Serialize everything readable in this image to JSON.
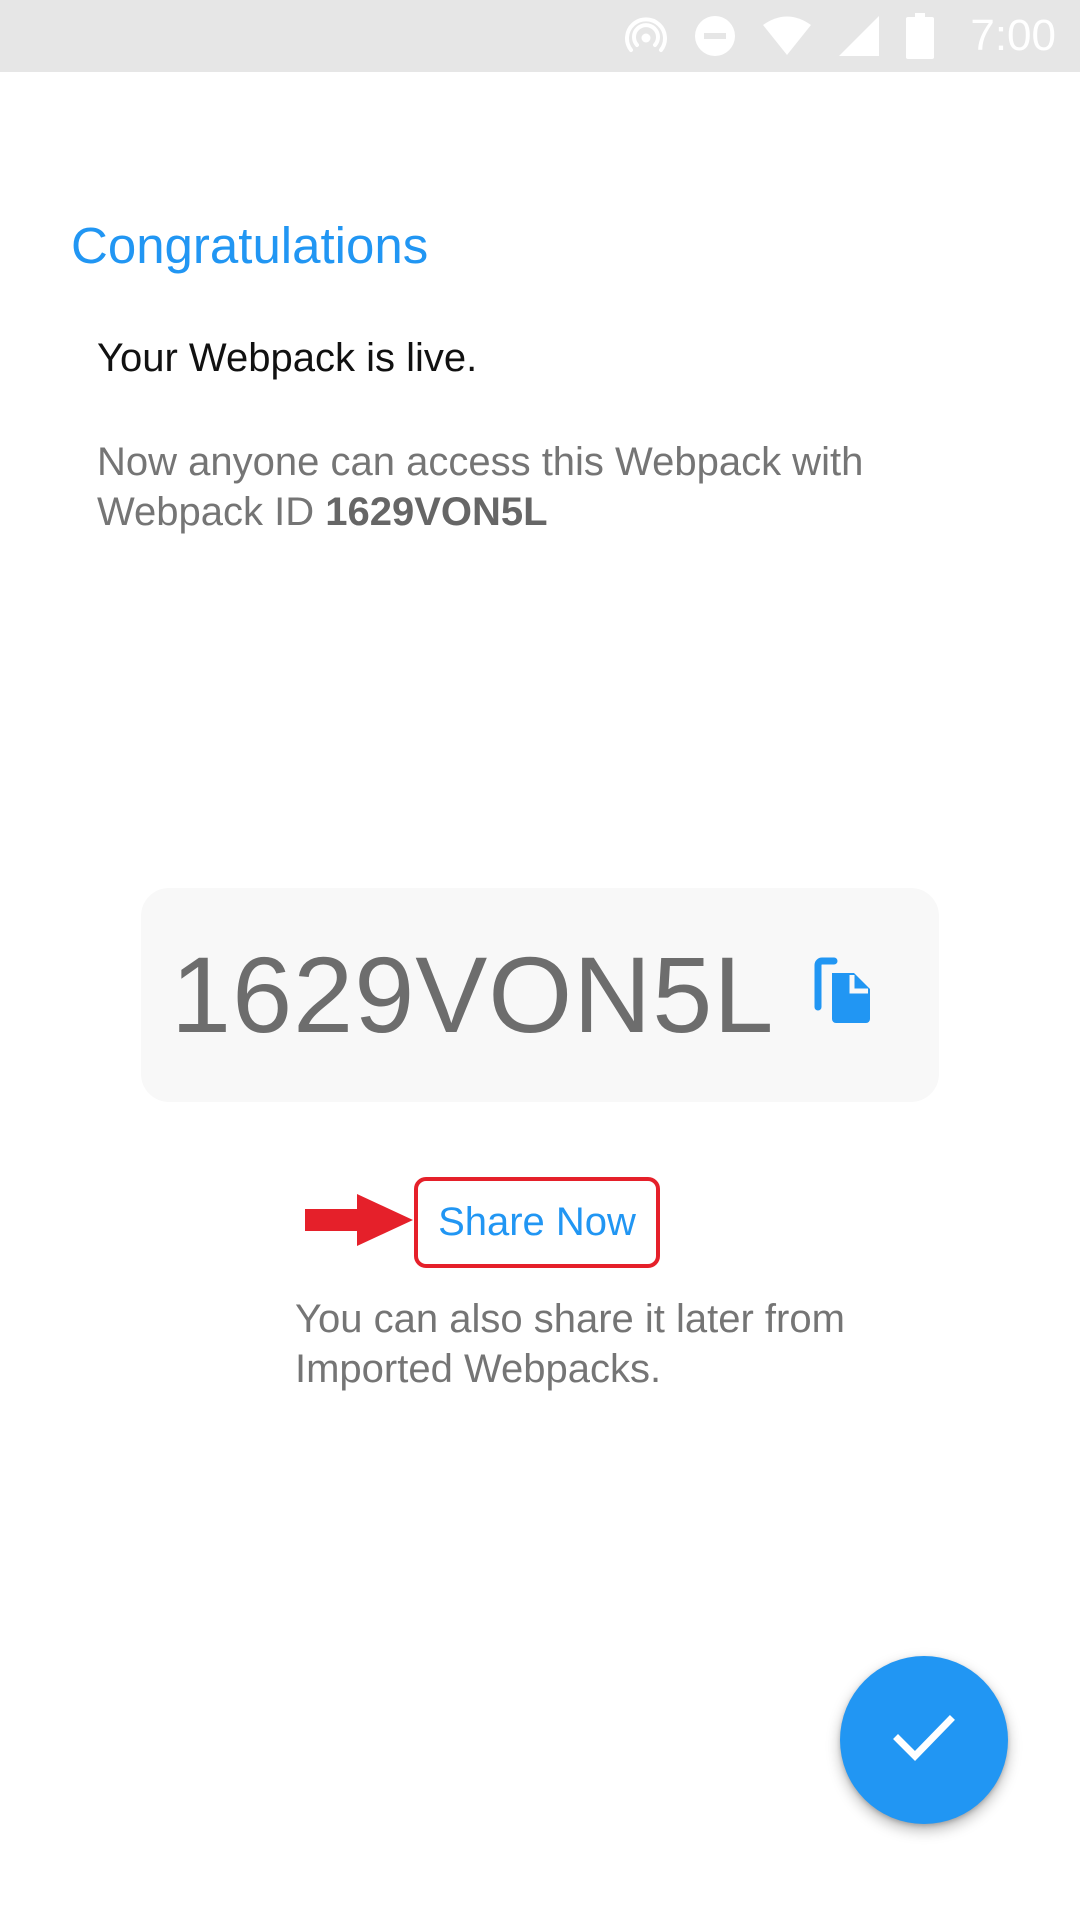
{
  "status_bar": {
    "time": "7:00",
    "icons": [
      "hotspot-icon",
      "do-not-disturb-icon",
      "wifi-icon",
      "cell-signal-icon",
      "battery-icon"
    ]
  },
  "header": {
    "title": "Congratulations"
  },
  "main": {
    "subtitle": "Your Webpack is live.",
    "description_prefix": "Now anyone can access this Webpack with Webpack ID ",
    "webpack_id": "1629VON5L",
    "id_card": {
      "id": "1629VON5L",
      "copy_icon": "copy-icon"
    },
    "share": {
      "label": "Share Now",
      "hint": "You can also share it later from Imported Webpacks."
    }
  },
  "fab": {
    "icon": "check-icon"
  },
  "colors": {
    "accent": "#2196f3",
    "annotation": "#e5202a",
    "status_bar_bg": "#e6e6e6"
  }
}
